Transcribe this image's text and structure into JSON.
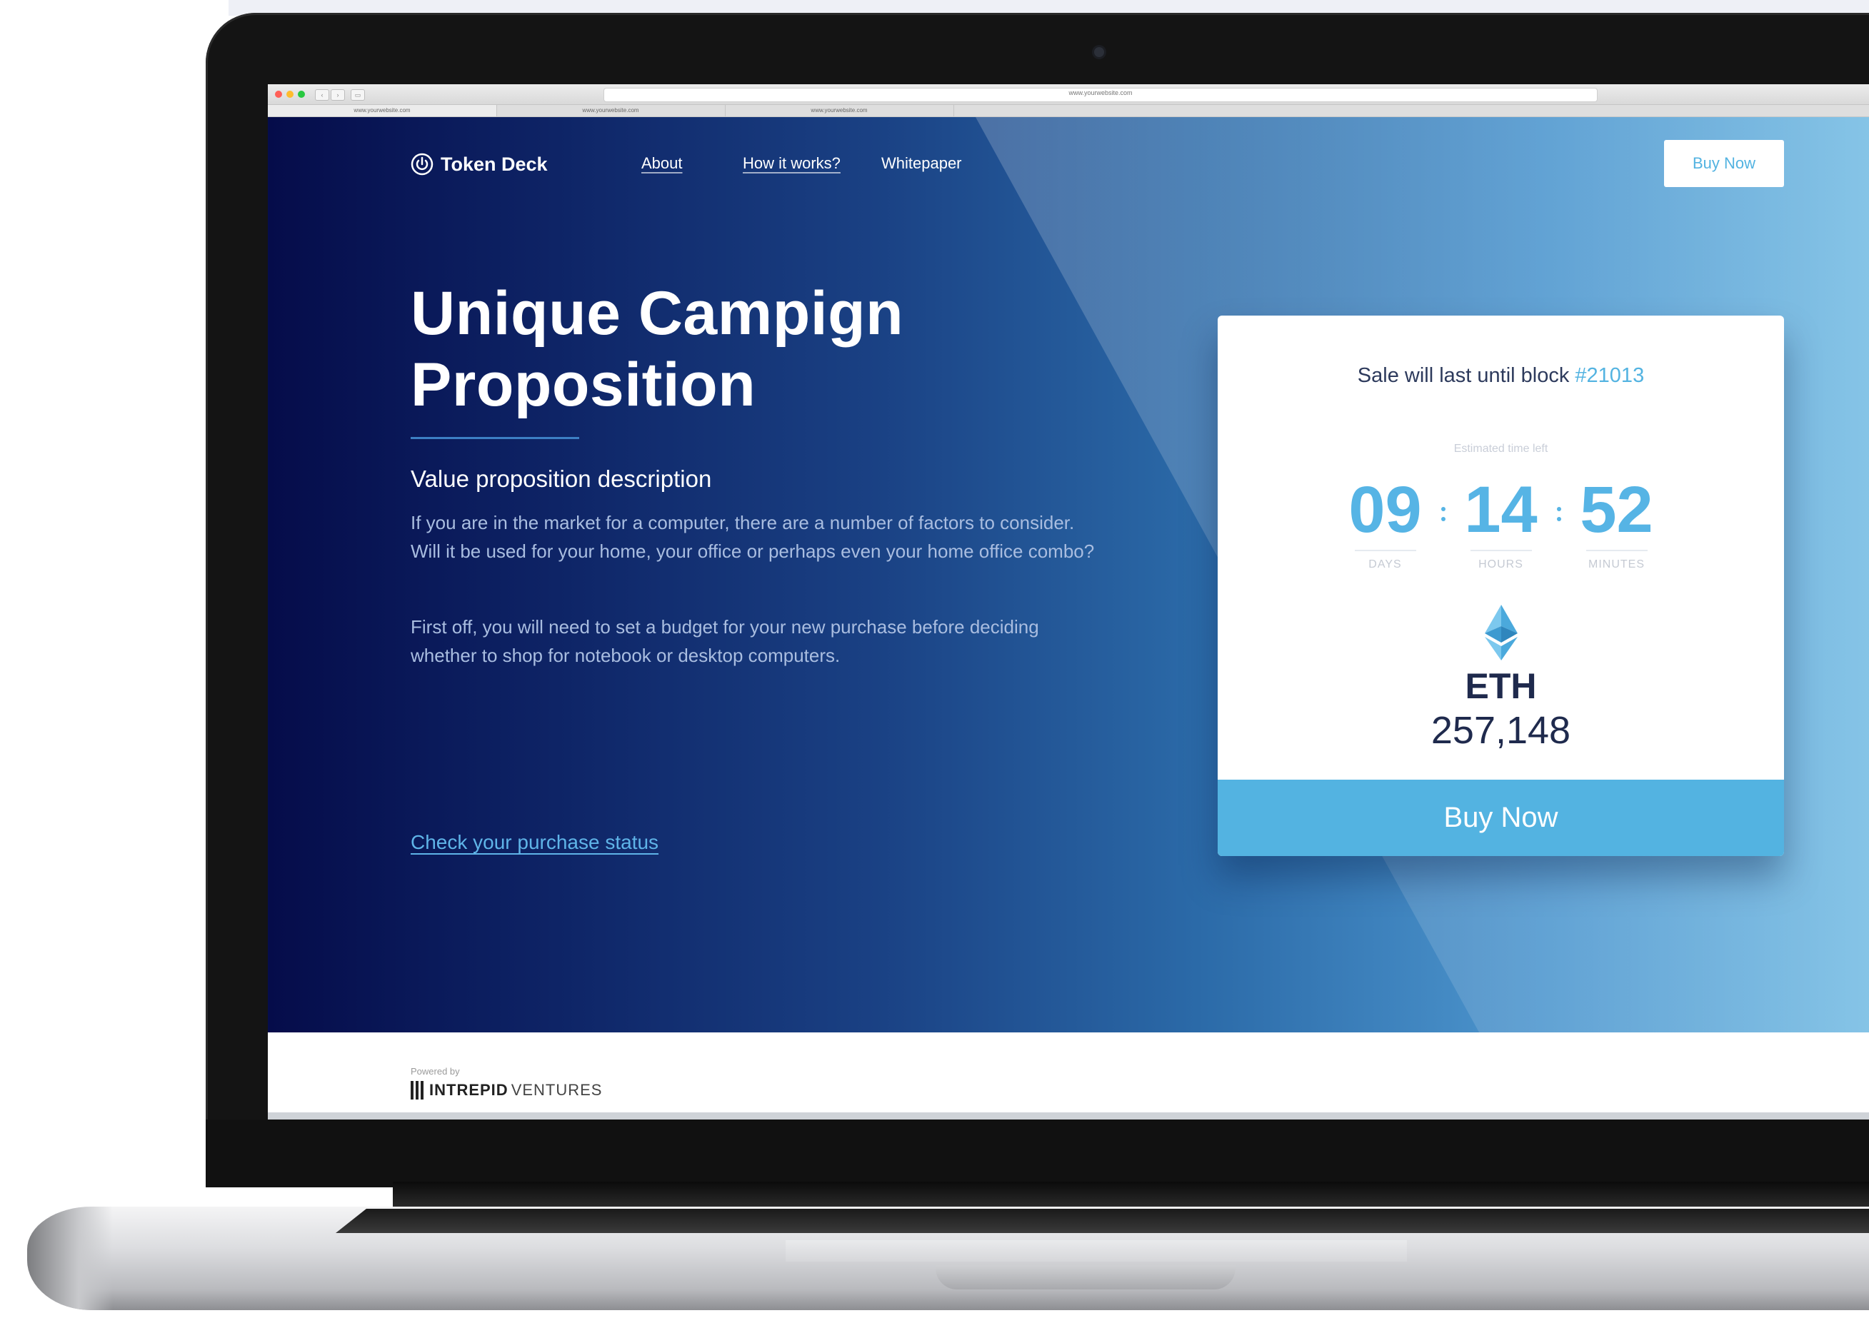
{
  "browser": {
    "url": "www.yourwebsite.com",
    "tabs": [
      "www.yourwebsite.com",
      "www.yourwebsite.com",
      "www.yourwebsite.com"
    ]
  },
  "header": {
    "brand": "Token Deck",
    "nav": {
      "about": "About",
      "how_it_works": "How it works?",
      "whitepaper": "Whitepaper",
      "buy_now": "Buy Now"
    }
  },
  "hero": {
    "title_line1": "Unique Campign",
    "title_line2": "Proposition",
    "subtitle": "Value proposition description",
    "paragraph1": "If you are in the market for a computer, there are a number of factors to consider. Will it be used for your home, your office or perhaps even your home office combo?",
    "paragraph2": "First off, you will need to set a budget for your new purchase before deciding whether to shop for notebook or desktop computers.",
    "check_link": "Check your purchase status"
  },
  "sale_card": {
    "sale_text": "Sale will last until block ",
    "block_number": "#21013",
    "estimated_label": "Estimated time left",
    "days": "09",
    "hours": "14",
    "minutes": "52",
    "days_label": "DAYS",
    "hours_label": "HOURS",
    "minutes_label": "MINUTES",
    "coin": "ETH",
    "amount": "257,148",
    "buy_button": "Buy Now"
  },
  "footer": {
    "powered_by": "Powered by",
    "brand_bold": "INTREPID",
    "brand_light": "VENTURES"
  },
  "colors": {
    "accent": "#53b3e1",
    "hero_dark": "#050c4a",
    "hero_light": "#7dc0e5",
    "text_dark": "#1f2a4d"
  },
  "icons": {
    "logo": "power-icon",
    "coin": "ethereum-icon"
  }
}
